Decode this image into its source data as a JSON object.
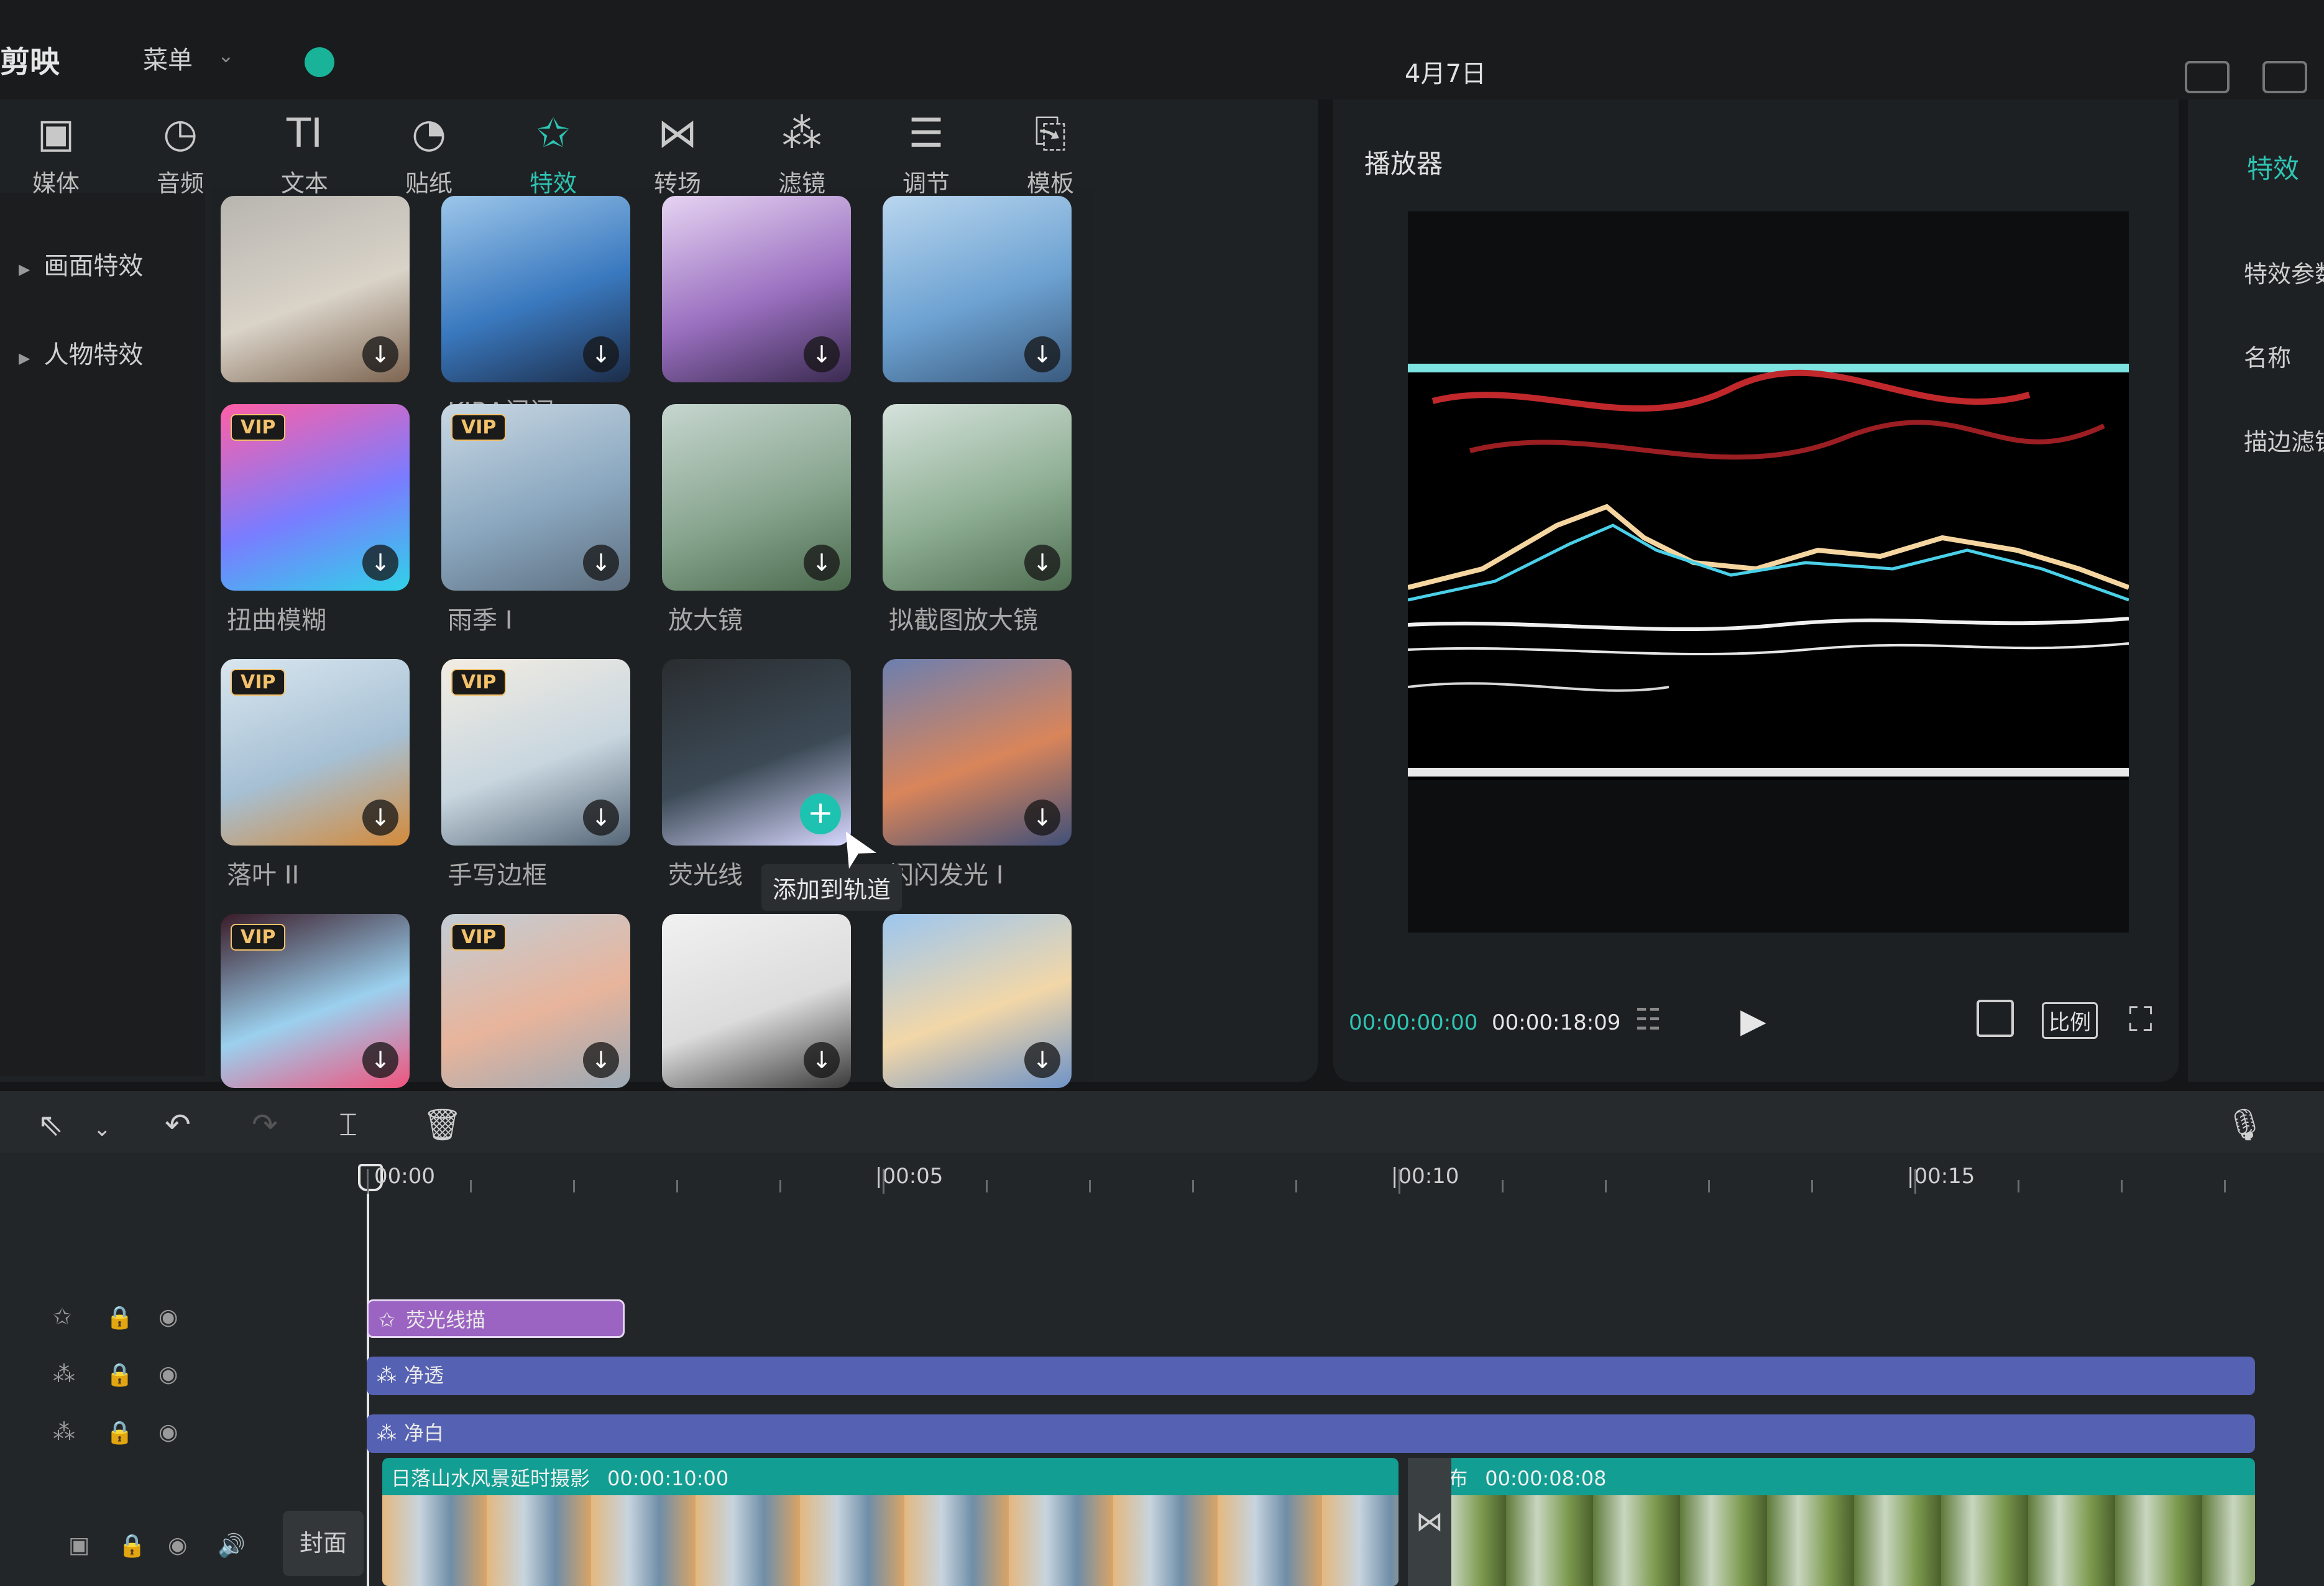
{
  "app": {
    "logo": "剪映",
    "menu": "菜单",
    "title": "4月7日"
  },
  "toolbar": [
    {
      "label": "媒体",
      "icon": "media-icon",
      "glyph": "▣",
      "active": false
    },
    {
      "label": "音频",
      "icon": "audio-icon",
      "glyph": "◷",
      "active": false
    },
    {
      "label": "文本",
      "icon": "text-icon",
      "glyph": "TI",
      "active": false
    },
    {
      "label": "贴纸",
      "icon": "sticker-icon",
      "glyph": "◔",
      "active": false
    },
    {
      "label": "特效",
      "icon": "effects-icon",
      "glyph": "✩",
      "active": true
    },
    {
      "label": "转场",
      "icon": "transition-icon",
      "glyph": "⋈",
      "active": false
    },
    {
      "label": "滤镜",
      "icon": "filter-icon",
      "glyph": "⁂",
      "active": false
    },
    {
      "label": "调节",
      "icon": "adjust-icon",
      "glyph": "☰",
      "active": false
    },
    {
      "label": "模板",
      "icon": "template-icon",
      "glyph": "⎘",
      "active": false
    }
  ],
  "categories": [
    "画面特效",
    "人物特效"
  ],
  "effects": [
    {
      "label": "",
      "vip": false,
      "colors": [
        "#b8b5b0",
        "#d9d3c8",
        "#7d6450"
      ]
    },
    {
      "label": "KIRA闪闪",
      "vip": false,
      "colors": [
        "#9cc6ea",
        "#3a79bf",
        "#1c2c48"
      ]
    },
    {
      "label": "",
      "vip": false,
      "colors": [
        "#e6d4f2",
        "#9a70c0",
        "#3a2a50"
      ]
    },
    {
      "label": "",
      "vip": false,
      "colors": [
        "#b9d6ee",
        "#6da2d2",
        "#3a5a7e"
      ]
    },
    {
      "label": "扭曲模糊",
      "vip": true,
      "colors": [
        "#ff5fa6",
        "#7a7cff",
        "#2fd2e8"
      ]
    },
    {
      "label": "雨季 I",
      "vip": true,
      "colors": [
        "#c9d8e4",
        "#8aa7bf",
        "#5e6f80"
      ]
    },
    {
      "label": "放大镜",
      "vip": false,
      "colors": [
        "#c6d6cf",
        "#88a58f",
        "#4b6a4d"
      ]
    },
    {
      "label": "拟截图放大镜",
      "vip": false,
      "colors": [
        "#d5e2dc",
        "#8eae93",
        "#4f6e52"
      ]
    },
    {
      "label": "落叶 II",
      "vip": true,
      "colors": [
        "#d9e6ef",
        "#a6c0d4",
        "#d48a3a"
      ]
    },
    {
      "label": "手写边框",
      "vip": true,
      "colors": [
        "#f3ede2",
        "#c8d6df",
        "#556677"
      ]
    },
    {
      "label": "荧光线",
      "vip": false,
      "colors": [
        "#2a2d30",
        "#3c4a56",
        "#d8d8ff"
      ],
      "hover": true
    },
    {
      "label": "闪闪发光 I",
      "vip": false,
      "colors": [
        "#6c7fb0",
        "#d9855a",
        "#40507a"
      ]
    },
    {
      "label": "",
      "vip": true,
      "colors": [
        "#3a1b28",
        "#9bd0ee",
        "#f0537d"
      ]
    },
    {
      "label": "",
      "vip": true,
      "colors": [
        "#c2cdd6",
        "#e8b49b",
        "#9aa9b6"
      ]
    },
    {
      "label": "",
      "vip": false,
      "colors": [
        "#f1f1f1",
        "#dcdcdc",
        "#3a3a3a"
      ]
    },
    {
      "label": "",
      "vip": false,
      "colors": [
        "#9cc6f0",
        "#f2d7a8",
        "#6e93c8"
      ]
    }
  ],
  "tooltip": "添加到轨道",
  "player": {
    "label": "播放器",
    "time_current": "00:00:00:00",
    "time_total": "00:00:18:09",
    "ratio_label": "比例"
  },
  "inspector": {
    "tab": "特效",
    "rows": [
      "特效参数",
      "名称",
      "描边滤镜"
    ]
  },
  "timeline": {
    "ruler": [
      "00:00",
      "|00:05",
      "|00:10",
      "|00:15"
    ],
    "tracks": [
      {
        "kind": "effect",
        "icon": "effect-track-icon",
        "glyph": "✩",
        "clip": "荧光线描",
        "color": "#9b63c2",
        "start": 0,
        "end": 2.5
      },
      {
        "kind": "filter",
        "icon": "filter-track-icon",
        "glyph": "⁂",
        "clip": "净透",
        "color": "#5561b3",
        "start": 0,
        "end": 18.3
      },
      {
        "kind": "filter",
        "icon": "filter-track-icon",
        "glyph": "⁂",
        "clip": "净白",
        "color": "#5561b3",
        "start": 0,
        "end": 18.3
      }
    ],
    "video_clips": [
      {
        "label": "日落山水风景延时摄影",
        "duration": "00:00:10:00",
        "start": 0,
        "end": 10
      },
      {
        "label": "瀑布",
        "duration": "00:00:08:08",
        "start": 10.2,
        "end": 18.3
      }
    ],
    "cover_label": "封面"
  }
}
